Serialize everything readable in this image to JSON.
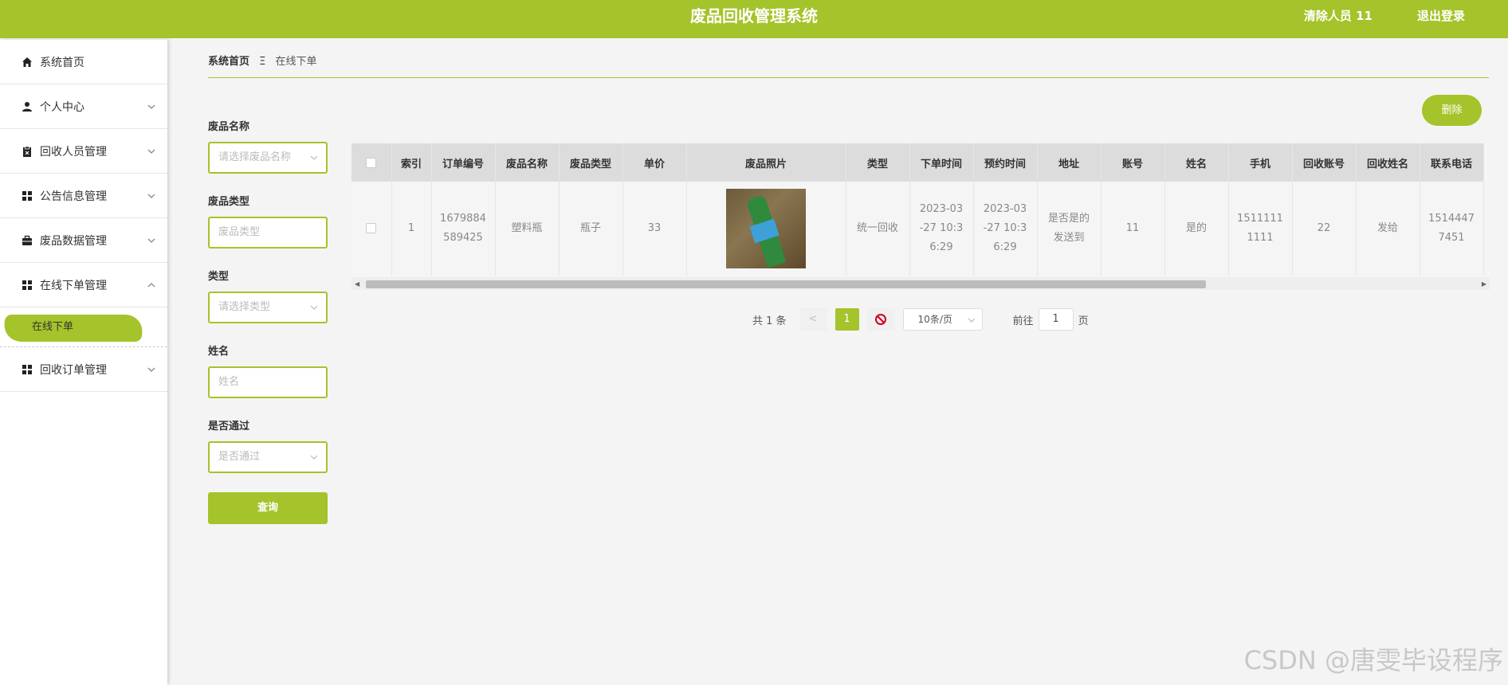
{
  "header": {
    "title": "废品回收管理系统",
    "user": "清除人员 11",
    "logout": "退出登录"
  },
  "sidebar": {
    "items": [
      {
        "label": "系统首页",
        "icon": "home-icon"
      },
      {
        "label": "个人中心",
        "icon": "user-icon"
      },
      {
        "label": "回收人员管理",
        "icon": "clipboard-icon"
      },
      {
        "label": "公告信息管理",
        "icon": "grid-icon"
      },
      {
        "label": "废品数据管理",
        "icon": "briefcase-icon"
      },
      {
        "label": "在线下单管理",
        "icon": "grid-icon"
      },
      {
        "label": "回收订单管理",
        "icon": "grid-icon"
      }
    ],
    "submenu": {
      "label": "在线下单"
    }
  },
  "breadcrumb": {
    "home": "系统首页",
    "sep": "Ξ",
    "current": "在线下单"
  },
  "search": {
    "fields": [
      {
        "label": "废品名称",
        "placeholder": "请选择废品名称"
      },
      {
        "label": "废品类型",
        "placeholder": "废品类型"
      },
      {
        "label": "类型",
        "placeholder": "请选择类型"
      },
      {
        "label": "姓名",
        "placeholder": "姓名"
      },
      {
        "label": "是否通过",
        "placeholder": "是否通过"
      }
    ],
    "button": "查询"
  },
  "delete_button": "删除",
  "table": {
    "columns": [
      "索引",
      "订单编号",
      "废品名称",
      "废品类型",
      "单价",
      "废品照片",
      "类型",
      "下单时间",
      "预约时间",
      "地址",
      "账号",
      "姓名",
      "手机",
      "回收账号",
      "回收姓名",
      "联系电话"
    ],
    "row": {
      "index": "1",
      "order_no": "1679884589425",
      "order_no_l1": "1679884",
      "order_no_l2": "589425",
      "name": "塑料瓶",
      "category": "瓶子",
      "price": "33",
      "type": "统一回收",
      "order_time_l1": "2023-03",
      "order_time_l2": "-27 10:3",
      "order_time_l3": "6:29",
      "reserve_time_l1": "2023-03",
      "reserve_time_l2": "-27 10:3",
      "reserve_time_l3": "6:29",
      "address_l1": "是否是的",
      "address_l2": "发送到",
      "account": "11",
      "user_name": "是的",
      "phone_l1": "1511111",
      "phone_l2": "1111",
      "recycle_account": "22",
      "recycle_name": "发给",
      "contact_l1": "1514447",
      "contact_l2": "7451"
    }
  },
  "pager": {
    "total": "共 1 条",
    "prev": "<",
    "page": "1",
    "size": "10条/页",
    "goto": "前往",
    "goto_value": "1",
    "page_unit": "页"
  },
  "watermark": "CSDN @唐雯毕设程序",
  "colors": {
    "accent": "#a5c32a"
  }
}
